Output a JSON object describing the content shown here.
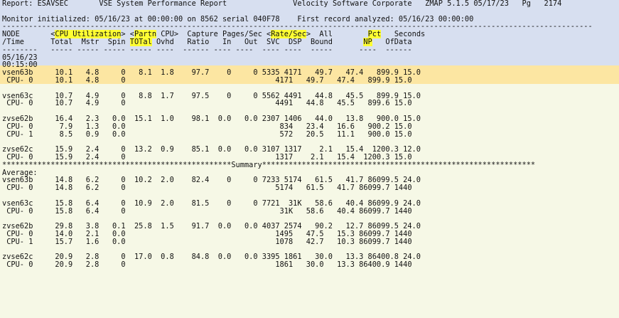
{
  "report_lines": [
    "Report: ESAVSEC       VSE System Performance Report               Velocity Software Corporate   ZMAP 5.1.5 05/17/23   Pg   2174",
    "",
    "Monitor initialized: 05/16/23 at 00:00:00 on 8562 serial 040F78    First record analyzed: 05/16/23 00:00:00",
    "--------------------------------------------------------------------------------------------------------------------------------------",
    "NODE       <CPU Utilization> <Partn CPU>  Capture Pages/Sec <Rate/Sec>  All        Pct   Seconds",
    "/Time      Total  Mstr  Spin TOTal Ovhd   Ratio   In   Out  SVC  DSP  Bound       NP   OfData",
    "--------   ----- ----- ----- ----- ----  ------ ---- ----  ---- ----  -----      ----  ------",
    "05/16/23",
    "00:15:00",
    "vsen63b     10.1   4.8     0   8.1  1.8    97.7    0     0 5335 4171   49.7   47.4   899.9 15.0",
    " CPU- 0     10.1   4.8     0                                  4171   49.7   47.4   899.9 15.0",
    "",
    "vsen63c     10.7   4.9     0   8.8  1.7    97.5    0     0 5562 4491   44.8   45.5   899.9 15.0",
    " CPU- 0     10.7   4.9     0                                  4491   44.8   45.5   899.6 15.0",
    "",
    "zvse62b     16.4   2.3   0.0  15.1  1.0    98.1  0.0   0.0 2307 1406   44.0   13.8   900.0 15.0",
    " CPU- 0      7.9   1.3   0.0                                   834   23.4   16.6   900.2 15.0",
    " CPU- 1      8.5   0.9   0.0                                   572   20.5   11.1   900.0 15.0",
    "",
    "zvse62c     15.9   2.4     0  13.2  0.9    85.1  0.0   0.0 3107 1317    2.1   15.4  1200.3 12.0",
    " CPU- 0     15.9   2.4     0                                  1317    2.1   15.4  1200.3 15.0",
    "****************************************************Summary**************************************************************",
    "Average:",
    "vsen63b     14.8   6.2     0  10.2  2.0    82.4    0     0 7233 5174   61.5   41.7 86099.5 24.0",
    " CPU- 0     14.8   6.2     0                                  5174   61.5   41.7 86099.7 1440",
    "",
    "vsen63c     15.8   6.4     0  10.9  2.0    81.5    0     0 7721  31K   58.6   40.4 86099.9 24.0",
    " CPU- 0     15.8   6.4     0                                   31K   58.6   40.4 86099.7 1440",
    "",
    "zvse62b     29.8   3.8   0.1  25.8  1.5    91.7  0.0   0.0 4037 2574   90.2   12.7 86099.5 24.0",
    " CPU- 0     14.0   2.1   0.0                                  1495   47.5   15.3 86099.7 1440",
    " CPU- 1     15.7   1.6   0.0                                  1078   42.7   10.3 86099.7 1440",
    "",
    "zvse62c     20.9   2.8     0  17.0  0.8    84.8  0.0   0.0 3395 1861   30.0   13.3 86400.8 24.0",
    " CPU- 0     20.9   2.8     0                                  1861   30.0   13.3 86400.9 1440"
  ],
  "highlights": [
    {
      "line": 4,
      "text": "CPU Utilization"
    },
    {
      "line": 4,
      "text": "Partn"
    },
    {
      "line": 4,
      "text": "Rate/Sec"
    },
    {
      "line": 4,
      "text": "Pct"
    },
    {
      "line": 5,
      "text": "TOTal"
    },
    {
      "line": 5,
      "text": "NP"
    }
  ]
}
